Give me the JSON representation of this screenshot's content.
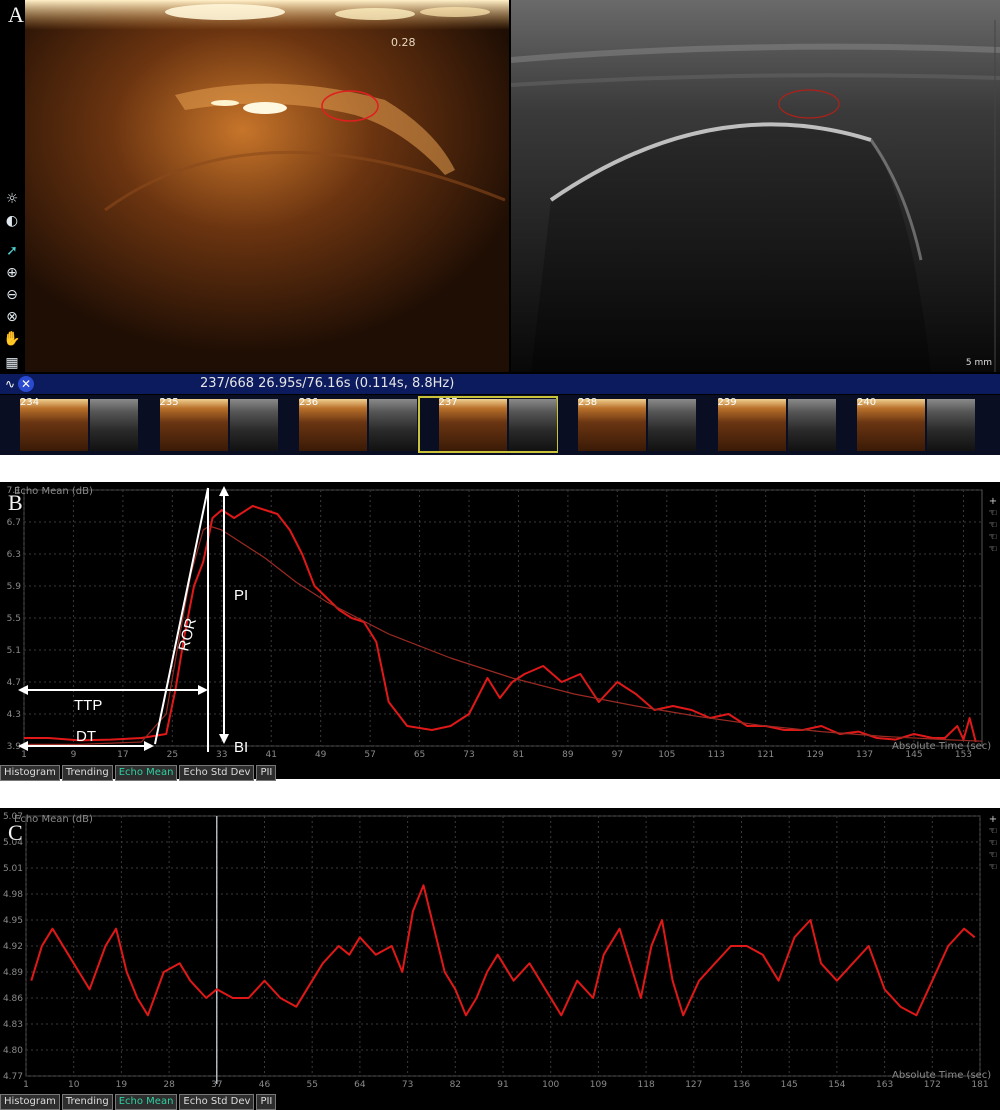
{
  "panel_labels": {
    "a": "A",
    "b": "B",
    "c": "C"
  },
  "panel_a": {
    "ceus_value": "0.28",
    "scale_label": "5 mm",
    "status": {
      "text": "237/668  26.95s/76.16s (0.114s, 8.8Hz)"
    },
    "toolbar": [
      "brightness-icon",
      "contrast-icon",
      "pointer-icon",
      "zoom-in-icon",
      "zoom-out-icon",
      "zoom-reset-icon",
      "pan-hand-icon",
      "grid-icon"
    ],
    "frames": [
      "234",
      "235",
      "236",
      "237",
      "238",
      "239",
      "240"
    ],
    "selected_frame": "237",
    "colors": {
      "roi": "#e02020",
      "status_bar": "#0c1a5e",
      "selected_frame": "#c9c23a"
    }
  },
  "panel_b": {
    "ylabel": "Echo Mean (dB)",
    "xlabel": "Absolute Time (sec)",
    "tabs": [
      "Histogram",
      "Trending",
      "Echo Mean",
      "Echo Std Dev",
      "PII"
    ],
    "active_tab": "Echo Mean",
    "annotations": {
      "ttp": "TTP",
      "dt": "DT",
      "ror": "ROR",
      "pi": "PI",
      "bi": "BI"
    }
  },
  "panel_c": {
    "ylabel": "Echo Mean (dB)",
    "xlabel": "Absolute Time (sec)",
    "tabs": [
      "Histogram",
      "Trending",
      "Echo Mean",
      "Echo Std Dev",
      "PII"
    ],
    "active_tab": "Echo Mean"
  },
  "chart_data": [
    {
      "type": "line",
      "ylabel": "Echo Mean (dB)",
      "xlabel": "Absolute Time (sec)",
      "y_ticks": [
        "3.9",
        "4.3",
        "4.7",
        "5.1",
        "5.5",
        "5.9",
        "6.3",
        "6.7",
        "7.1"
      ],
      "x_ticks": [
        "1",
        "9",
        "17",
        "25",
        "33",
        "41",
        "49",
        "57",
        "65",
        "73",
        "81",
        "89",
        "97",
        "105",
        "113",
        "121",
        "129",
        "137",
        "145",
        "153"
      ],
      "xlim": [
        1,
        156
      ],
      "ylim": [
        3.9,
        7.1
      ],
      "grid": true,
      "series": [
        {
          "color": "#e01818",
          "x": [
            1,
            5,
            10,
            15,
            20,
            24,
            25.5,
            27,
            28.5,
            30,
            31.5,
            33,
            35,
            38,
            40,
            42,
            44,
            46,
            48,
            50,
            52,
            54,
            56,
            58,
            60,
            63,
            67,
            70,
            73,
            76,
            78,
            80,
            82,
            85,
            88,
            91,
            94,
            97,
            100,
            103,
            106,
            109,
            112,
            115,
            118,
            121,
            124,
            127,
            130,
            133,
            136,
            139,
            142,
            145,
            148,
            150,
            152,
            153,
            154,
            155
          ],
          "y": [
            4.0,
            4.0,
            3.97,
            3.98,
            4.0,
            4.05,
            4.6,
            5.3,
            5.9,
            6.2,
            6.75,
            6.85,
            6.75,
            6.9,
            6.85,
            6.8,
            6.6,
            6.3,
            5.9,
            5.75,
            5.6,
            5.5,
            5.45,
            5.2,
            4.45,
            4.15,
            4.1,
            4.15,
            4.3,
            4.75,
            4.5,
            4.7,
            4.8,
            4.9,
            4.7,
            4.8,
            4.45,
            4.7,
            4.55,
            4.35,
            4.4,
            4.35,
            4.25,
            4.3,
            4.15,
            4.15,
            4.1,
            4.1,
            4.15,
            4.05,
            4.08,
            4.0,
            3.98,
            4.05,
            4.0,
            4.0,
            4.15,
            3.98,
            4.25,
            3.95
          ]
        },
        {
          "color": "#9a2a22",
          "x": [
            1,
            10,
            20,
            24,
            26,
            28,
            30,
            31,
            33,
            36,
            40,
            45,
            50,
            55,
            60,
            70,
            80,
            90,
            100,
            110,
            120,
            130,
            140,
            150,
            156
          ],
          "y": [
            3.92,
            3.92,
            3.95,
            4.3,
            5.2,
            6.05,
            6.6,
            6.65,
            6.6,
            6.45,
            6.25,
            5.95,
            5.7,
            5.5,
            5.3,
            5.0,
            4.75,
            4.55,
            4.4,
            4.27,
            4.16,
            4.08,
            4.02,
            3.98,
            3.96
          ]
        }
      ]
    },
    {
      "type": "line",
      "ylabel": "Echo Mean (dB)",
      "xlabel": "Absolute Time (sec)",
      "y_ticks": [
        "4.77",
        "4.80",
        "4.83",
        "4.86",
        "4.89",
        "4.92",
        "4.95",
        "4.98",
        "5.01",
        "5.04",
        "5.07"
      ],
      "x_ticks": [
        "1",
        "10",
        "19",
        "28",
        "37",
        "46",
        "55",
        "64",
        "73",
        "82",
        "91",
        "100",
        "109",
        "118",
        "127",
        "136",
        "145",
        "154",
        "163",
        "172",
        "181"
      ],
      "xlim": [
        1,
        181
      ],
      "ylim": [
        4.77,
        5.07
      ],
      "grid": true,
      "cursor_x": 37,
      "series": [
        {
          "color": "#e01818",
          "x": [
            2,
            4,
            6,
            9,
            11,
            13,
            16,
            18,
            20,
            22,
            24,
            27,
            30,
            32,
            35,
            37,
            40,
            43,
            46,
            49,
            52,
            54,
            57,
            60,
            62,
            64,
            67,
            70,
            72,
            74,
            76,
            78,
            80,
            82,
            84,
            86,
            88,
            90,
            93,
            96,
            99,
            102,
            105,
            108,
            110,
            113,
            115,
            117,
            119,
            121,
            123,
            125,
            128,
            131,
            134,
            137,
            140,
            143,
            146,
            149,
            151,
            154,
            157,
            160,
            163,
            166,
            169,
            172,
            175,
            178,
            180
          ],
          "y": [
            4.88,
            4.92,
            4.94,
            4.91,
            4.89,
            4.87,
            4.92,
            4.94,
            4.89,
            4.86,
            4.84,
            4.89,
            4.9,
            4.88,
            4.86,
            4.87,
            4.86,
            4.86,
            4.88,
            4.86,
            4.85,
            4.87,
            4.9,
            4.92,
            4.91,
            4.93,
            4.91,
            4.92,
            4.89,
            4.96,
            4.99,
            4.94,
            4.89,
            4.87,
            4.84,
            4.86,
            4.89,
            4.91,
            4.88,
            4.9,
            4.87,
            4.84,
            4.88,
            4.86,
            4.91,
            4.94,
            4.9,
            4.86,
            4.92,
            4.95,
            4.88,
            4.84,
            4.88,
            4.9,
            4.92,
            4.92,
            4.91,
            4.88,
            4.93,
            4.95,
            4.9,
            4.88,
            4.9,
            4.92,
            4.87,
            4.85,
            4.84,
            4.88,
            4.92,
            4.94,
            4.93
          ]
        }
      ]
    }
  ]
}
